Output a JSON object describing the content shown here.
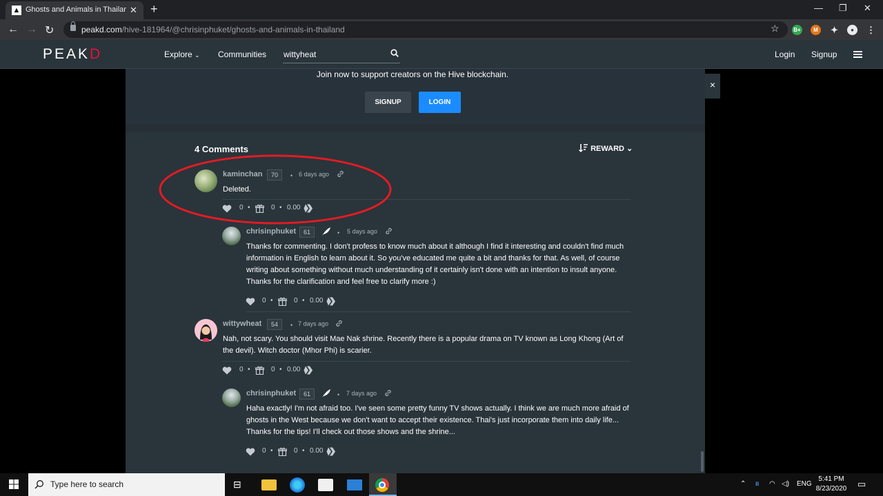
{
  "browser": {
    "tab_title": "Ghosts and Animals in Thailand |",
    "url_host": "peakd.com",
    "url_path": "/hive-181964/@chrisinphuket/ghosts-and-animals-in-thailand",
    "extension_badge": "B+"
  },
  "header": {
    "logo_main": "PEAK",
    "logo_accent": "D",
    "nav": {
      "explore": "Explore",
      "communities": "Communities"
    },
    "search_value": "wittyheat",
    "login": "Login",
    "signup": "Signup"
  },
  "join_banner": {
    "text": "Join now to support creators on the Hive blockchain.",
    "signup_btn": "SIGNUP",
    "login_btn": "LOGIN",
    "close": "×"
  },
  "comments_section": {
    "title": "4 Comments",
    "sort_label": "REWARD",
    "comments": [
      {
        "author": "kaminchan",
        "reputation": "70",
        "time": "6 days ago",
        "body": "Deleted.",
        "votes": "0",
        "tips": "0",
        "payout": "0.00"
      },
      {
        "author": "chrisinphuket",
        "reputation": "61",
        "time": "5 days ago",
        "body": "Thanks for commenting. I don't profess to know much about it although I find it interesting and couldn't find much information in English to learn about it. So you've educated me quite a bit and thanks for that. As well, of course writing about something without much understanding of it certainly isn't done with an intention to insult anyone. Thanks for the clarification and feel free to clarify more :)",
        "votes": "0",
        "tips": "0",
        "payout": "0.00"
      },
      {
        "author": "wittywheat",
        "reputation": "54",
        "time": "7 days ago",
        "body": "Nah, not scary. You should visit Mae Nak shrine. Recently there is a popular drama on TV known as Long Khong (Art of the devil). Witch doctor (Mhor Phi) is scarier.",
        "votes": "0",
        "tips": "0",
        "payout": "0.00"
      },
      {
        "author": "chrisinphuket",
        "reputation": "61",
        "time": "7 days ago",
        "body": "Haha exactly! I'm not afraid too. I've seen some pretty funny TV shows actually. I think we are much more afraid of ghosts in the West because we don't want to accept their existence. Thai's just incorporate them into daily life... Thanks for the tips! I'll check out those shows and the shrine...",
        "votes": "0",
        "tips": "0",
        "payout": "0.00"
      }
    ]
  },
  "taskbar": {
    "search_placeholder": "Type here to search",
    "language": "ENG",
    "time": "5:41 PM",
    "date": "8/23/2020"
  },
  "colors": {
    "accent_blue": "#1a8cff",
    "logo_red": "#e31337",
    "annotation_red": "#e31b23",
    "panel_bg": "#2a343b"
  },
  "icons": [
    "search-icon",
    "heart-icon",
    "gift-icon",
    "hive-icon",
    "link-icon",
    "quill-icon",
    "sort-icon",
    "chevron-down-icon",
    "close-icon",
    "hamburger-icon",
    "lock-icon",
    "star-icon"
  ]
}
